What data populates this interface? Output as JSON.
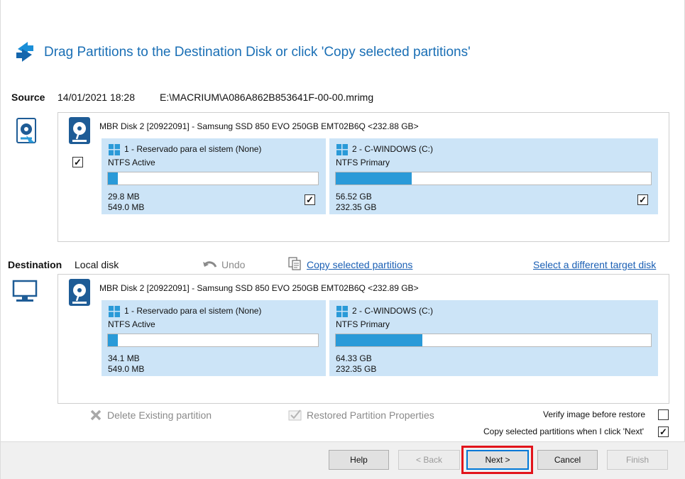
{
  "header": {
    "title": "Drag Partitions to the Destination Disk or click 'Copy selected partitions'"
  },
  "source": {
    "label": "Source",
    "date": "14/01/2021 18:28",
    "path": "E:\\MACRIUM\\A086A862B853641F-00-00.mrimg",
    "disk_title": "MBR Disk 2 [20922091] - Samsung SSD 850 EVO 250GB EMT02B6Q  <232.88 GB>",
    "disk_checked": true,
    "partitions": [
      {
        "name": "1 - Reservado para el sistem (None)",
        "type": "NTFS Active",
        "used": "29.8 MB",
        "total": "549.0 MB",
        "fill_fraction": 0.03,
        "checked": true
      },
      {
        "name": "2 - C-WINDOWS (C:)",
        "type": "NTFS Primary",
        "used": "56.52 GB",
        "total": "232.35 GB",
        "fill_fraction": 0.24,
        "checked": true
      }
    ]
  },
  "destination": {
    "label": "Destination",
    "value": "Local disk",
    "undo_label": "Undo",
    "copy_link": "Copy selected partitions",
    "select_target_link": "Select a different target disk",
    "disk_title": "MBR Disk 2 [20922091] - Samsung SSD 850 EVO 250GB EMT02B6Q  <232.89 GB>",
    "partitions": [
      {
        "name": "1 - Reservado para el sistem (None)",
        "type": "NTFS Active",
        "used": "34.1 MB",
        "total": "549.0 MB",
        "fill_fraction": 0.03
      },
      {
        "name": "2 - C-WINDOWS (C:)",
        "type": "NTFS Primary",
        "used": "64.33 GB",
        "total": "232.35 GB",
        "fill_fraction": 0.27
      }
    ]
  },
  "actions": {
    "delete_label": "Delete Existing partition",
    "restored_props_label": "Restored Partition Properties",
    "verify_label": "Verify image before restore",
    "verify_checked": false,
    "copy_on_next_label": "Copy selected partitions when I click 'Next'",
    "copy_on_next_checked": true
  },
  "buttons": {
    "help": "Help",
    "back": "< Back",
    "next": "Next >",
    "cancel": "Cancel",
    "finish": "Finish"
  },
  "colors": {
    "accent": "#1a6fb5",
    "partition_bg": "#cce4f7",
    "bar_fill": "#2a9ad8",
    "highlight": "#e2141b"
  },
  "icons": {
    "header": "swap-arrows-icon",
    "source_side": "image-file-icon",
    "destination_side": "monitor-icon",
    "disk": "hard-disk-icon",
    "partition": "windows-logo-icon",
    "undo": "undo-icon",
    "copy": "copy-icon",
    "delete": "delete-x-icon",
    "properties": "properties-check-icon"
  }
}
